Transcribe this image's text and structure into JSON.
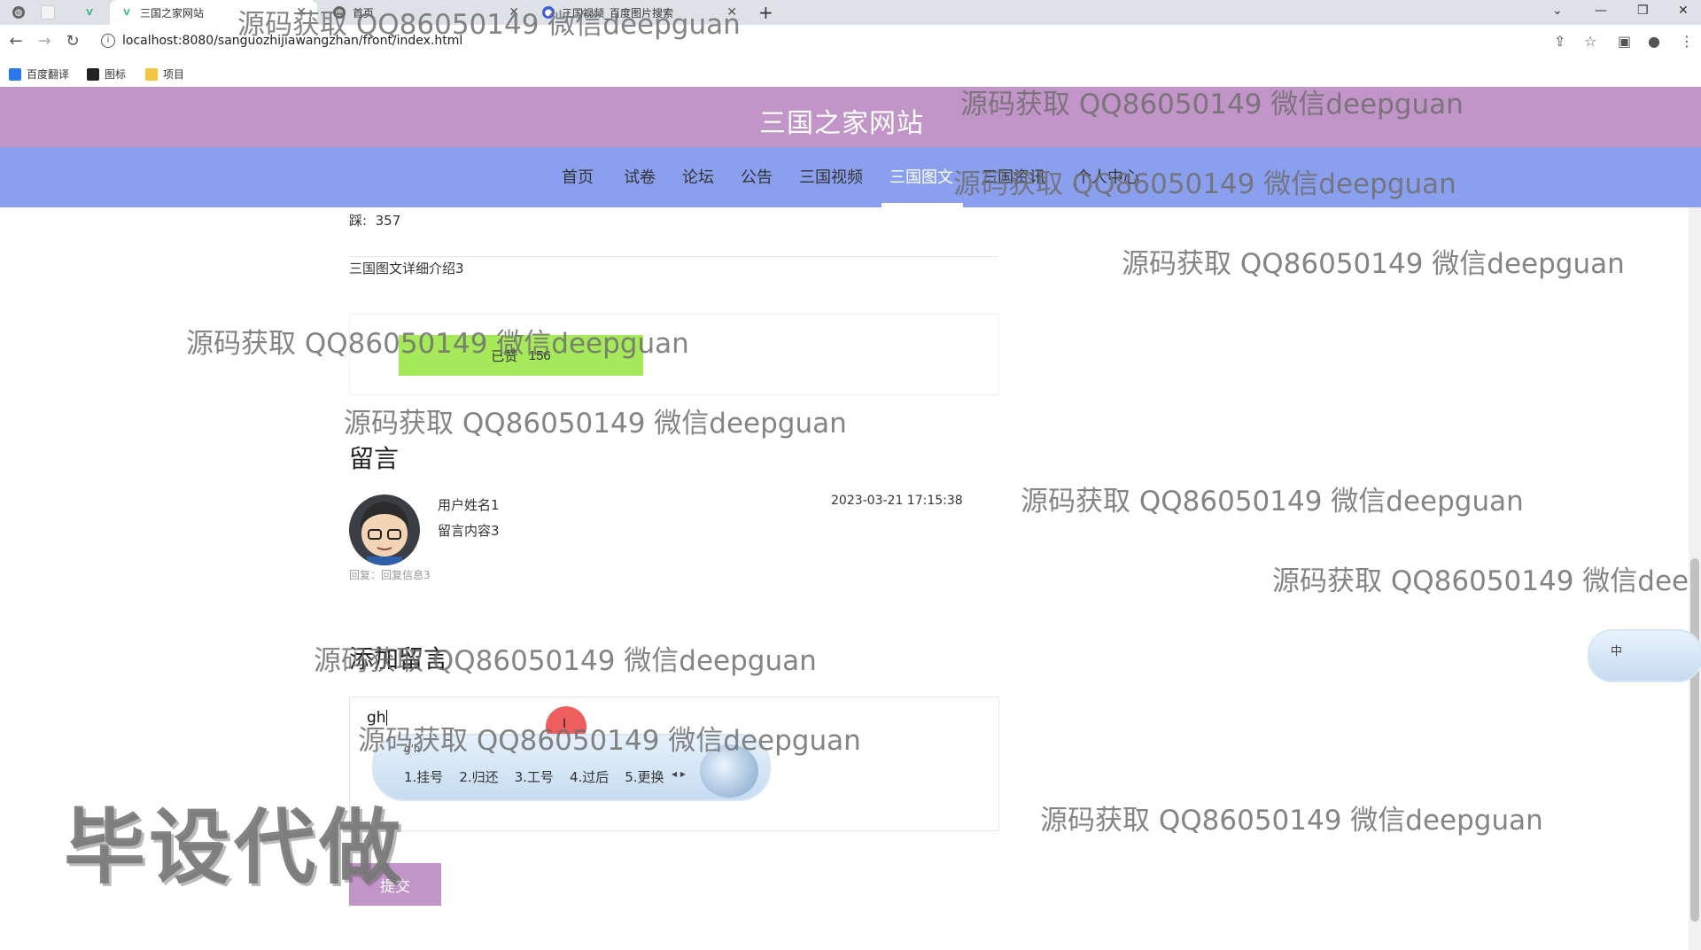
{
  "browser": {
    "tabs": [
      {
        "label": "三国之家网站",
        "icon": "vue-icon"
      },
      {
        "label": "首页",
        "icon": "globe-icon"
      },
      {
        "label": "三国视频_百度图片搜索",
        "icon": "baidu-icon"
      }
    ],
    "url": "localhost:8080/sanguozhijiawangzhan/front/index.html",
    "bookmarks": [
      {
        "label": "百度翻译"
      },
      {
        "label": "图标"
      },
      {
        "label": "项目"
      }
    ]
  },
  "site": {
    "title": "三国之家网站",
    "nav": [
      "首页",
      "试卷",
      "论坛",
      "公告",
      "三国视频",
      "三国图文",
      "三国资讯",
      "个人中心"
    ],
    "active_nav": "三国图文",
    "colors": {
      "header": "#c195c7",
      "nav": "#8aa0ee",
      "like": "#a6ea5b",
      "submit": "#c195c7"
    }
  },
  "detail": {
    "dislike_label": "踩:",
    "dislike_count": "357",
    "text": "三国图文详细介绍3",
    "like_label": "已赞",
    "like_count": "156"
  },
  "messages": {
    "heading": "留言",
    "items": [
      {
        "user": "用户姓名1",
        "content": "留言内容3",
        "time": "2023-03-21 17:15:38",
        "reply": "回复：回复信息3"
      }
    ]
  },
  "add_message": {
    "heading": "添加留言",
    "typed_value": "gh",
    "submit_label": "提交"
  },
  "ime": {
    "composition": "g'h",
    "candidates": [
      "1.挂号",
      "2.归还",
      "3.工号",
      "4.过后",
      "5.更换"
    ],
    "float_label": "中"
  },
  "watermarks": {
    "text": "源码获取 QQ86050149 微信deepguan",
    "stamp": "毕设代做"
  }
}
